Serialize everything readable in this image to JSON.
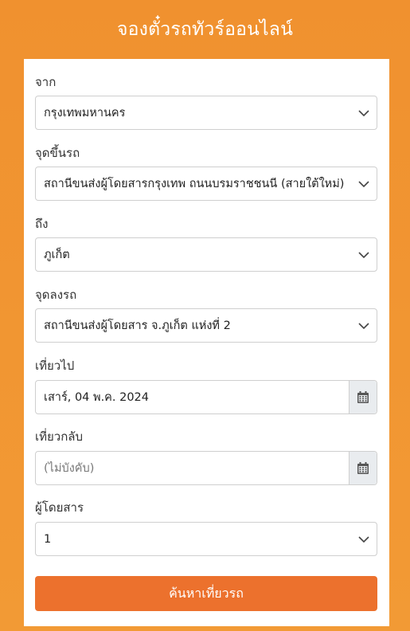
{
  "header": {
    "title": "จองตั๋วรถทัวร์ออนไลน์"
  },
  "form": {
    "from": {
      "label": "จาก",
      "value": "กรุงเทพมหานคร"
    },
    "pickup": {
      "label": "จุดขึ้นรถ",
      "value": "สถานีขนส่งผู้โดยสารกรุงเทพ ถนนบรมราชชนนี (สายใต้ใหม่)"
    },
    "to": {
      "label": "ถึง",
      "value": "ภูเก็ต"
    },
    "dropoff": {
      "label": "จุดลงรถ",
      "value": "สถานีขนส่งผู้โดยสาร จ.ภูเก็ต แห่งที่ 2"
    },
    "depart": {
      "label": "เที่ยวไป",
      "value": "เสาร์, 04 พ.ค. 2024"
    },
    "return": {
      "label": "เที่ยวกลับ",
      "placeholder": "(ไม่บังคับ)"
    },
    "passengers": {
      "label": "ผู้โดยสาร",
      "value": "1"
    },
    "submit_label": "ค้นหาเที่ยวรถ"
  },
  "colors": {
    "background": "#f0912f",
    "button": "#ec712d",
    "card": "#ffffff"
  },
  "icons": {
    "select_arrow": "chevron-down-icon",
    "date_picker": "calendar-icon"
  }
}
